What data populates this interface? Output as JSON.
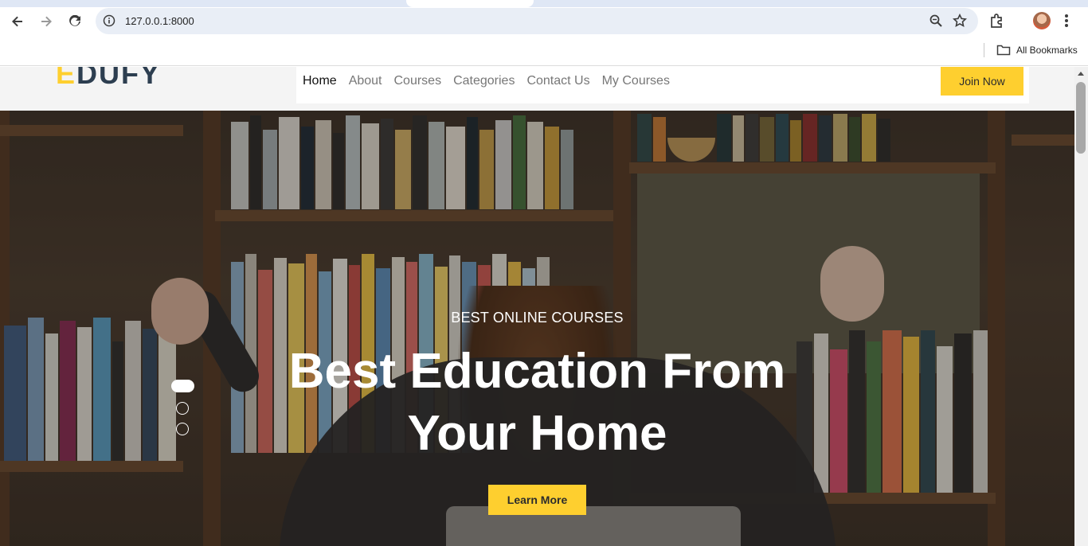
{
  "browser": {
    "url": "127.0.0.1:8000",
    "bookmarks_label": "All Bookmarks",
    "icons": [
      "back-icon",
      "forward-icon",
      "reload-icon",
      "info-icon",
      "zoom-icon",
      "star-icon",
      "extensions-icon",
      "profile-avatar",
      "menu-icon",
      "folder-icon"
    ]
  },
  "site": {
    "logo_first": "E",
    "logo_rest": "DUFY",
    "nav": [
      {
        "label": "Home",
        "active": true
      },
      {
        "label": "About"
      },
      {
        "label": "Courses"
      },
      {
        "label": "Categories"
      },
      {
        "label": "Contact Us"
      },
      {
        "label": "My Courses"
      }
    ],
    "join_label": "Join Now"
  },
  "hero": {
    "subtitle": "BEST ONLINE COURSES",
    "title_line1": "Best Education From",
    "title_line2": "Your Home",
    "button_label": "Learn More",
    "slides": 3,
    "active_slide": 1
  },
  "colors": {
    "accent": "#fecf2f",
    "logo_dark": "#2d3e50",
    "nav_text": "#777777",
    "nav_active": "#111111"
  }
}
